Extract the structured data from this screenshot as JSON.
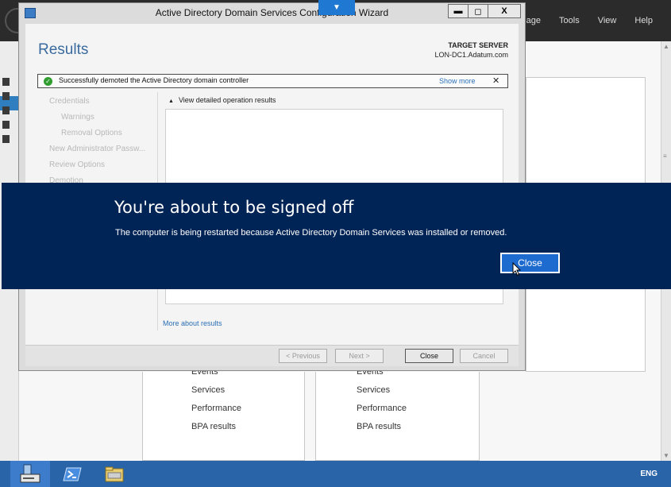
{
  "server_manager": {
    "menu": [
      "Manage",
      "Tools",
      "View",
      "Help"
    ],
    "tiles": [
      {
        "items": [
          "Events",
          "Services",
          "Performance",
          "BPA results"
        ]
      },
      {
        "items": [
          "Events",
          "Services",
          "Performance",
          "BPA results"
        ]
      }
    ]
  },
  "wizard": {
    "title": "Active Directory Domain Services Configuration Wizard",
    "heading": "Results",
    "target_server_label": "TARGET SERVER",
    "target_server_value": "LON-DC1.Adatum.com",
    "notification": {
      "text": "Successfully demoted the Active Directory domain controller",
      "show_more": "Show more"
    },
    "steps": [
      "Credentials",
      "Warnings",
      "Removal Options",
      "New Administrator Passw...",
      "Review Options",
      "Demotion"
    ],
    "detail_toggle": "View detailed operation results",
    "more_link": "More about results",
    "buttons": {
      "previous": "< Previous",
      "next": "Next >",
      "close": "Close",
      "cancel": "Cancel"
    }
  },
  "signoff": {
    "title": "You're about to be signed off",
    "message": "The computer is being restarted because Active Directory Domain Services was installed or removed.",
    "close_label": "Close"
  },
  "taskbar": {
    "language": "ENG"
  }
}
